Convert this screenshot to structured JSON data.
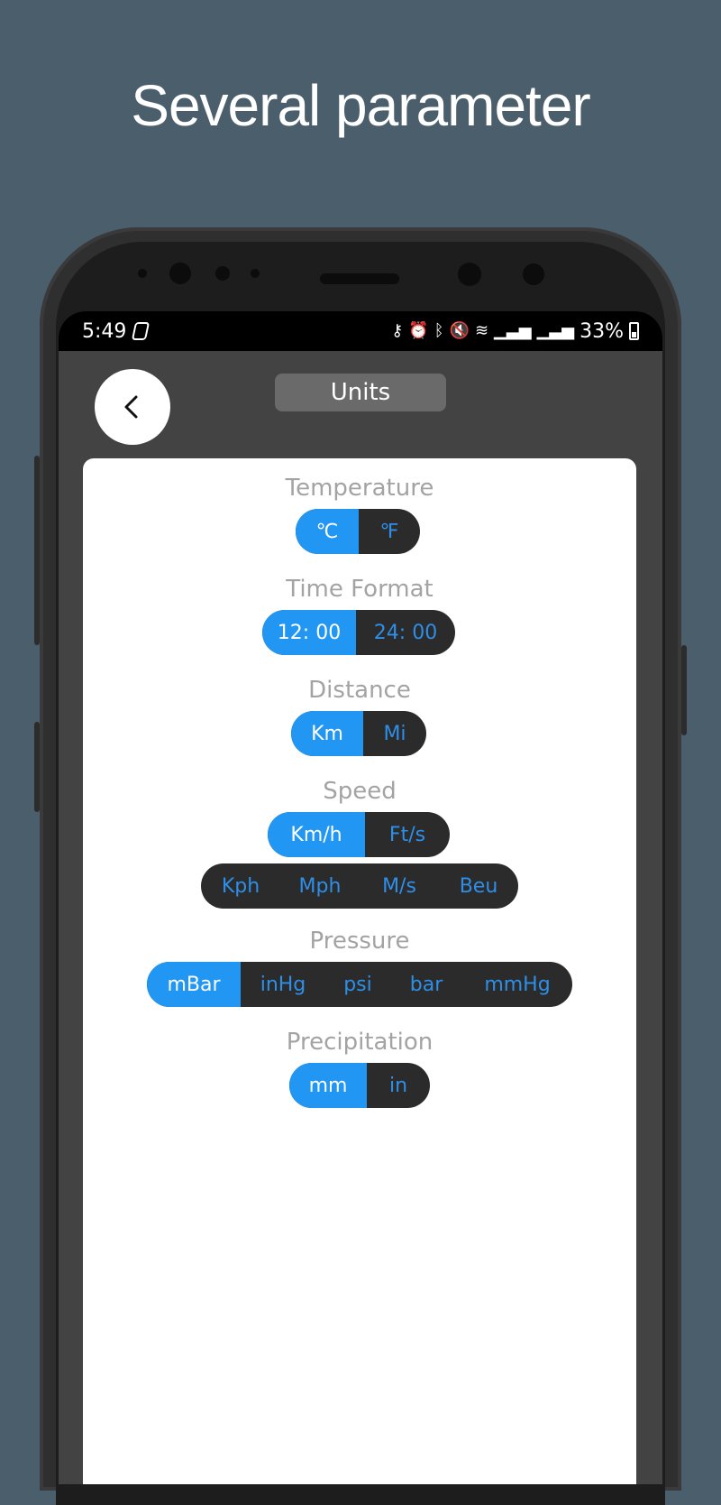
{
  "headline": "Several parameter",
  "status_bar": {
    "time": "5:49",
    "battery": "33%",
    "icons": [
      "key-icon",
      "alarm-icon",
      "bluetooth-icon",
      "mute-icon",
      "wifi-icon",
      "signal-icon",
      "signal-icon",
      "battery-icon"
    ]
  },
  "app_bar": {
    "title": "Units",
    "back_icon": "chevron-left-icon"
  },
  "colors": {
    "selected": "#2196f3",
    "unselected_bg": "#2b2b2b",
    "unselected_text": "#2e8fe8",
    "label": "#a3a3a3"
  },
  "units": {
    "temperature": {
      "label": "Temperature",
      "options": [
        "℃",
        "℉"
      ],
      "selected": "℃"
    },
    "time_format": {
      "label": "Time Format",
      "options": [
        "12: 00",
        "24: 00"
      ],
      "selected": "12: 00"
    },
    "distance": {
      "label": "Distance",
      "options": [
        "Km",
        "Mi"
      ],
      "selected": "Km"
    },
    "speed": {
      "label": "Speed",
      "options": [
        "Km/h",
        "Ft/s"
      ],
      "selected": "Km/h",
      "extra_options": [
        "Kph",
        "Mph",
        "M/s",
        "Beu"
      ]
    },
    "pressure": {
      "label": "Pressure",
      "options": [
        "mBar",
        "inHg",
        "psi",
        "bar",
        "mmHg"
      ],
      "selected": "mBar"
    },
    "precipitation": {
      "label": "Precipitation",
      "options": [
        "mm",
        "in"
      ],
      "selected": "mm"
    }
  }
}
